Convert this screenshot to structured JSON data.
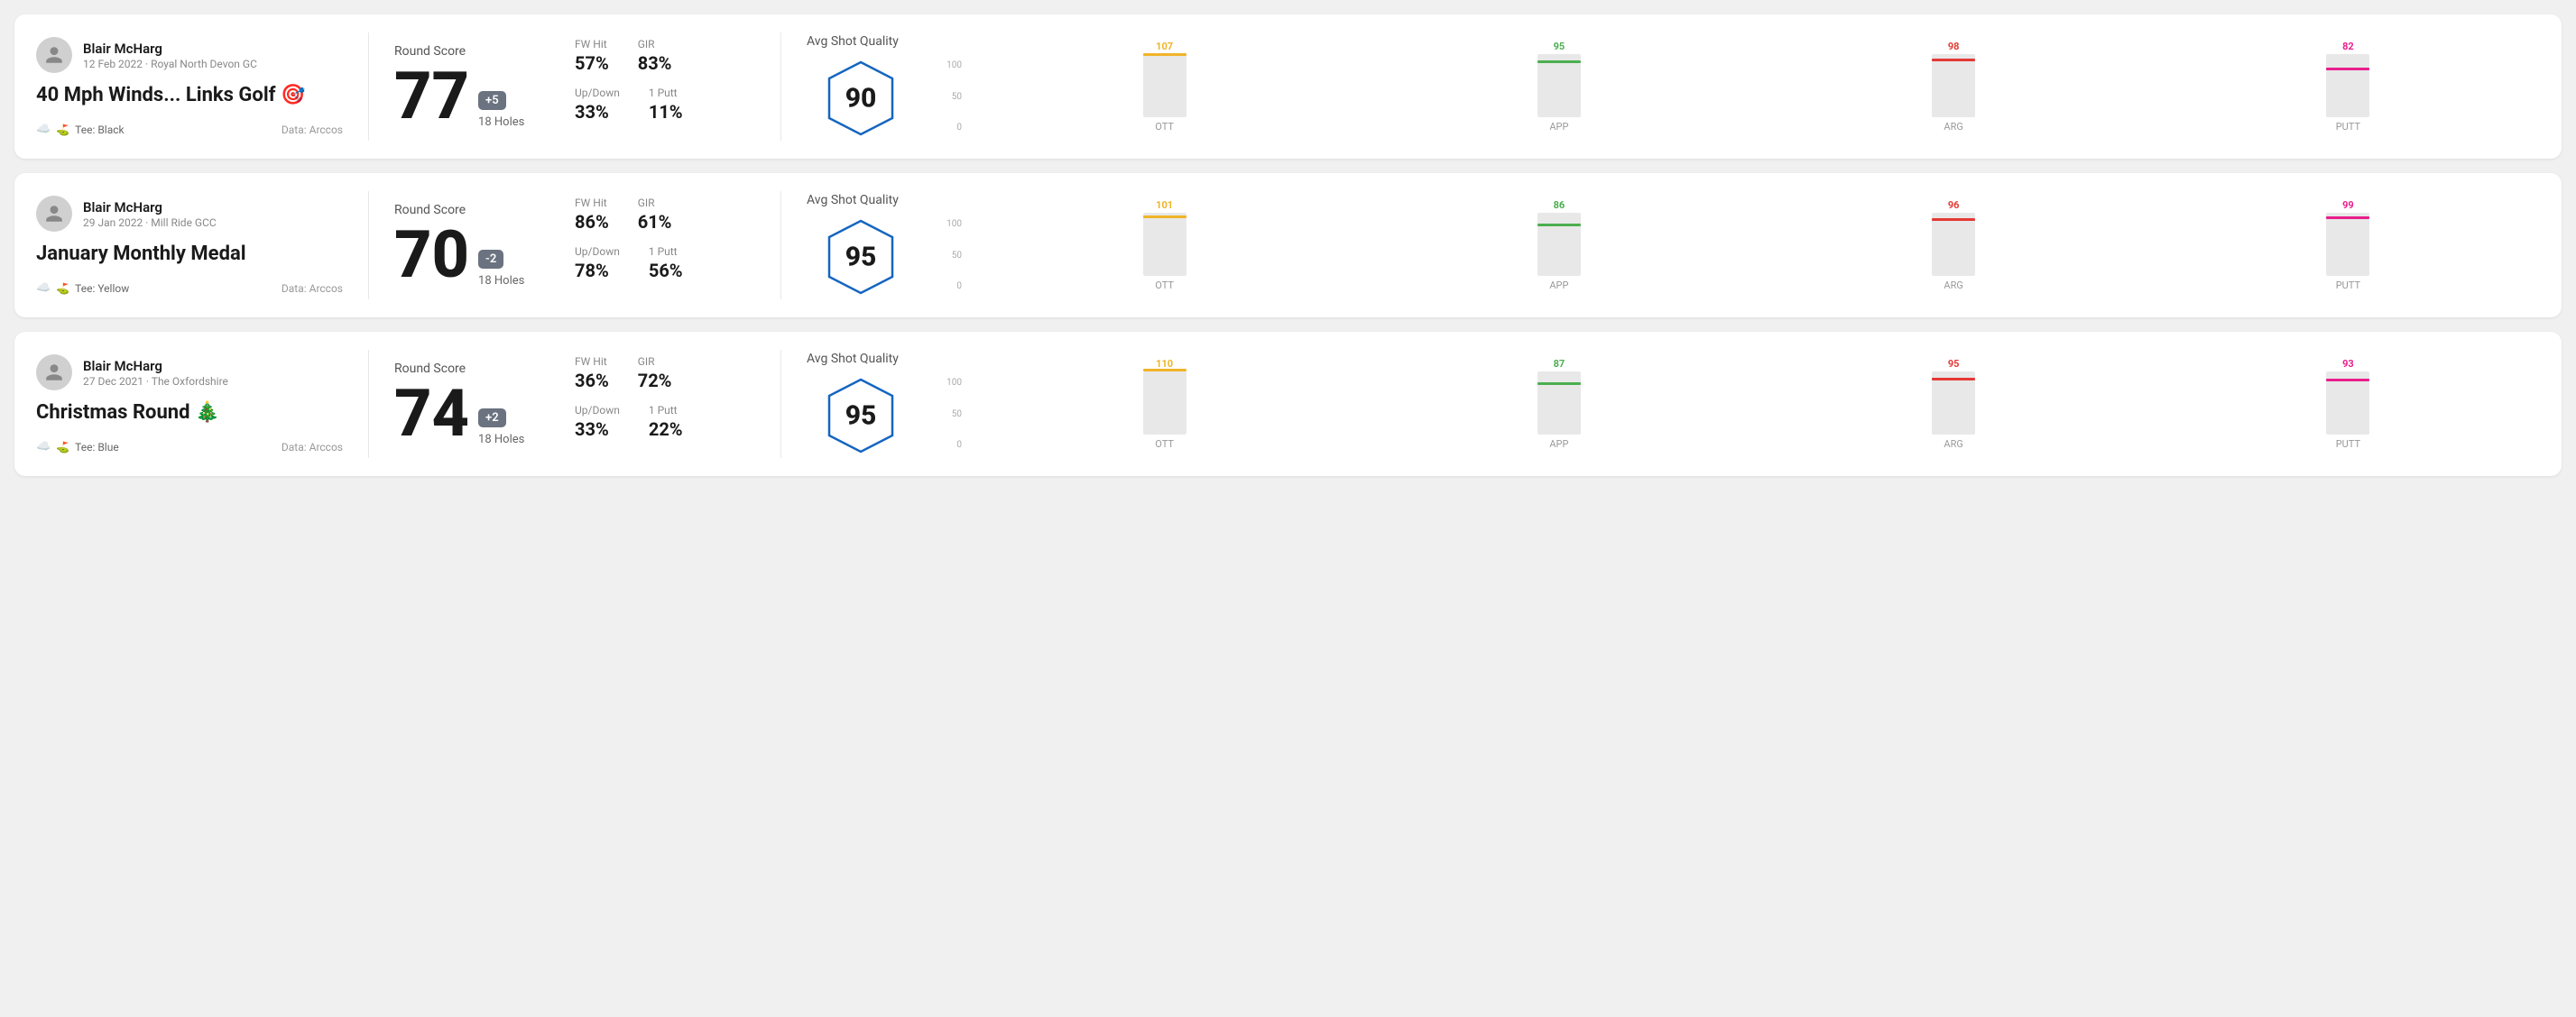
{
  "rounds": [
    {
      "id": "round1",
      "player_name": "Blair McHarg",
      "player_meta": "12 Feb 2022 · Royal North Devon GC",
      "round_title": "40 Mph Winds... Links Golf 🎯",
      "tee": "Tee: Black",
      "data_source": "Data: Arccos",
      "score": "77",
      "score_diff": "+5",
      "score_diff_type": "positive",
      "holes": "18 Holes",
      "fw_hit": "57%",
      "gir": "83%",
      "updown": "33%",
      "one_putt": "11%",
      "avg_quality": "90",
      "chart": {
        "bars": [
          {
            "label": "OTT",
            "value": 107,
            "color": "#f0b429",
            "line_pct": 100
          },
          {
            "label": "APP",
            "value": 95,
            "color": "#4caf50",
            "line_pct": 89
          },
          {
            "label": "ARG",
            "value": 98,
            "color": "#e53935",
            "line_pct": 92
          },
          {
            "label": "PUTT",
            "value": 82,
            "color": "#e91e8c",
            "line_pct": 77
          }
        ]
      }
    },
    {
      "id": "round2",
      "player_name": "Blair McHarg",
      "player_meta": "29 Jan 2022 · Mill Ride GCC",
      "round_title": "January Monthly Medal",
      "tee": "Tee: Yellow",
      "data_source": "Data: Arccos",
      "score": "70",
      "score_diff": "-2",
      "score_diff_type": "negative",
      "holes": "18 Holes",
      "fw_hit": "86%",
      "gir": "61%",
      "updown": "78%",
      "one_putt": "56%",
      "avg_quality": "95",
      "chart": {
        "bars": [
          {
            "label": "OTT",
            "value": 101,
            "color": "#f0b429",
            "line_pct": 95
          },
          {
            "label": "APP",
            "value": 86,
            "color": "#4caf50",
            "line_pct": 81
          },
          {
            "label": "ARG",
            "value": 96,
            "color": "#e53935",
            "line_pct": 90
          },
          {
            "label": "PUTT",
            "value": 99,
            "color": "#e91e8c",
            "line_pct": 93
          }
        ]
      }
    },
    {
      "id": "round3",
      "player_name": "Blair McHarg",
      "player_meta": "27 Dec 2021 · The Oxfordshire",
      "round_title": "Christmas Round 🎄",
      "tee": "Tee: Blue",
      "data_source": "Data: Arccos",
      "score": "74",
      "score_diff": "+2",
      "score_diff_type": "positive",
      "holes": "18 Holes",
      "fw_hit": "36%",
      "gir": "72%",
      "updown": "33%",
      "one_putt": "22%",
      "avg_quality": "95",
      "chart": {
        "bars": [
          {
            "label": "OTT",
            "value": 110,
            "color": "#f0b429",
            "line_pct": 100
          },
          {
            "label": "APP",
            "value": 87,
            "color": "#4caf50",
            "line_pct": 79
          },
          {
            "label": "ARG",
            "value": 95,
            "color": "#e53935",
            "line_pct": 86
          },
          {
            "label": "PUTT",
            "value": 93,
            "color": "#e91e8c",
            "line_pct": 85
          }
        ]
      }
    }
  ],
  "y_axis_labels": [
    "100",
    "50",
    "0"
  ]
}
